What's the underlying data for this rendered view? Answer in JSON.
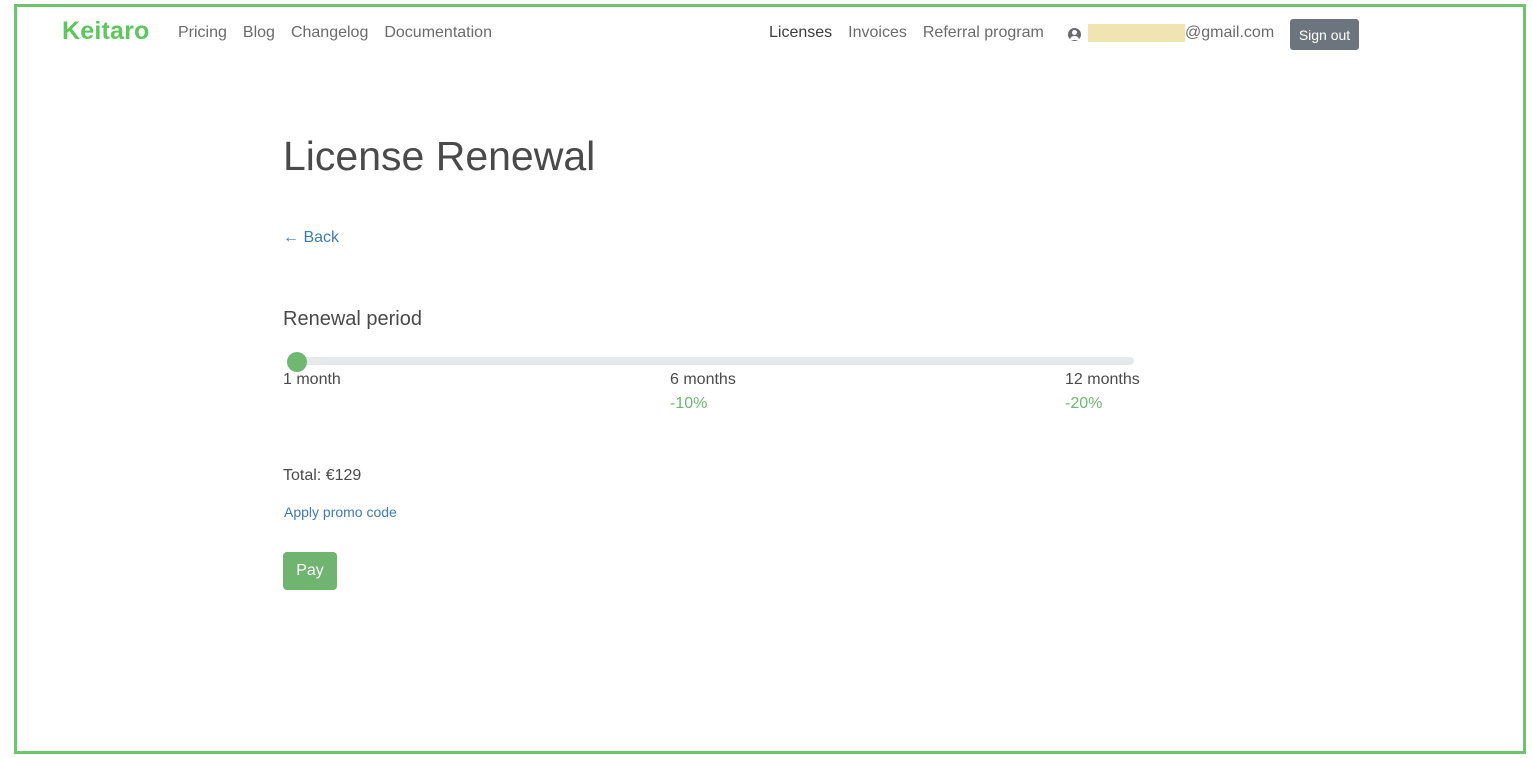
{
  "header": {
    "brand": "Keitaro",
    "nav_left": [
      {
        "label": "Pricing"
      },
      {
        "label": "Blog"
      },
      {
        "label": "Changelog"
      },
      {
        "label": "Documentation"
      }
    ],
    "nav_right": [
      {
        "label": "Licenses",
        "active": true
      },
      {
        "label": "Invoices"
      },
      {
        "label": "Referral program"
      }
    ],
    "user_email_suffix": "@gmail.com",
    "sign_out_label": "Sign out"
  },
  "main": {
    "title": "License Renewal",
    "back_label": "← Back",
    "renewal_section_title": "Renewal period",
    "slider": {
      "min_months": 1,
      "max_months": 12,
      "selected_months": 1,
      "ticks": [
        {
          "label": "1 month",
          "discount": ""
        },
        {
          "label": "6 months",
          "discount": "-10%"
        },
        {
          "label": "12 months",
          "discount": "-20%"
        }
      ]
    },
    "total": "Total: €129",
    "promo_label": "Apply promo code",
    "pay_label": "Pay"
  },
  "colors": {
    "brand": "#5cc85c",
    "accent": "#6fb86f",
    "link": "#3e7cb1",
    "secondary_button": "#6c757d",
    "frame_border": "#6cc46c"
  }
}
